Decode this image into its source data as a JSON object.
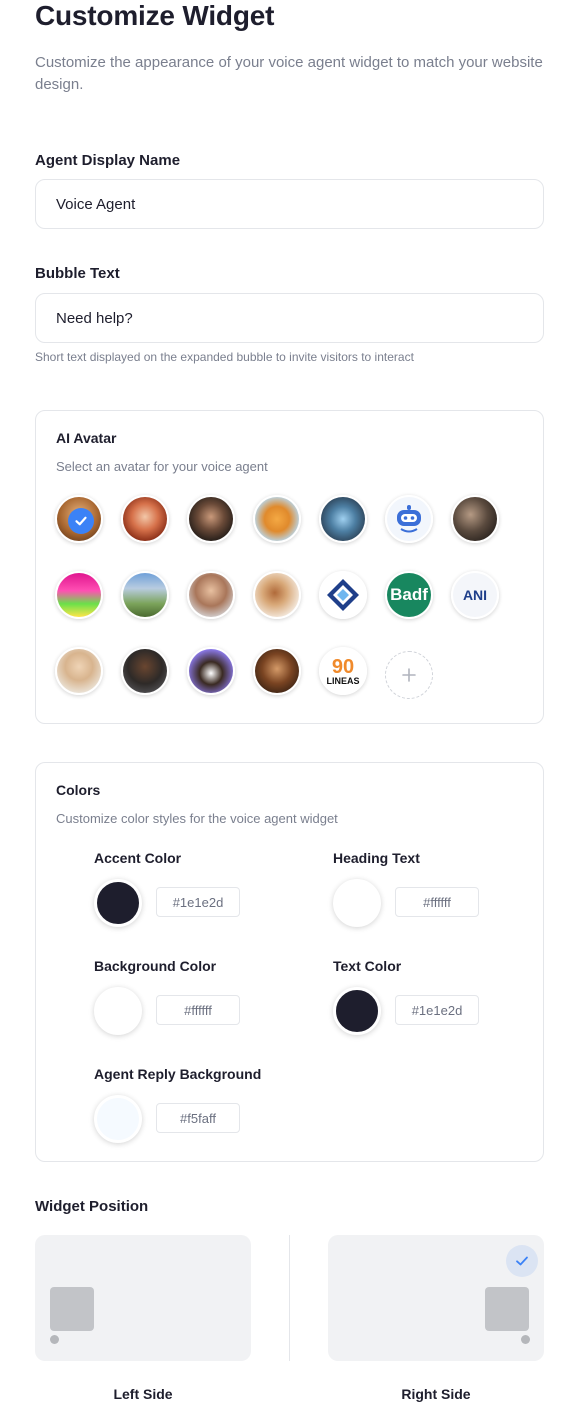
{
  "header": {
    "title": "Customize Widget",
    "subtitle": "Customize the appearance of your voice agent widget to match your website design."
  },
  "agent_name": {
    "label": "Agent Display Name",
    "value": "Voice Agent"
  },
  "bubble": {
    "label": "Bubble Text",
    "value": "Need help?",
    "hint": "Short text displayed on the expanded bubble to invite visitors to interact"
  },
  "avatars": {
    "title": "AI Avatar",
    "subtitle": "Select an avatar for your voice agent",
    "selected_index": 0,
    "items": [
      {
        "name": "avatar-1",
        "color": "#c58a52"
      },
      {
        "name": "avatar-2",
        "color": "#b4532e"
      },
      {
        "name": "avatar-3",
        "color": "#3a2e28"
      },
      {
        "name": "avatar-4",
        "color": "#e69a3c"
      },
      {
        "name": "avatar-5",
        "color": "#4a6d8c"
      },
      {
        "name": "avatar-6",
        "color": "#eef3fb"
      },
      {
        "name": "avatar-7",
        "color": "#4b4038"
      },
      {
        "name": "avatar-8",
        "color": "#d93b9b"
      },
      {
        "name": "avatar-9",
        "color": "#8aa36b"
      },
      {
        "name": "avatar-10",
        "color": "#c9a48a"
      },
      {
        "name": "avatar-11",
        "color": "#d7b287"
      },
      {
        "name": "avatar-12",
        "color": "#2a4a9a"
      },
      {
        "name": "avatar-13",
        "color": "#1a8a63"
      },
      {
        "name": "avatar-14",
        "color": "#f1f3f8"
      },
      {
        "name": "avatar-15",
        "color": "#dcc6a8"
      },
      {
        "name": "avatar-16",
        "color": "#3a3a3e"
      },
      {
        "name": "avatar-17",
        "color": "#8f7df2"
      },
      {
        "name": "avatar-18",
        "color": "#6b3f22"
      },
      {
        "name": "avatar-19",
        "color": "#f08a2b"
      }
    ],
    "logo_texts": {
      "badf": "Badf",
      "ani": "ANI",
      "ninety": "90",
      "lineas": "LINEAS"
    }
  },
  "colors": {
    "title": "Colors",
    "subtitle": "Customize color styles for the voice agent widget",
    "items": [
      {
        "label": "Accent Color",
        "hex": "#1e1e2d",
        "swatch": "#1e1e2d"
      },
      {
        "label": "Heading Text",
        "hex": "#ffffff",
        "swatch": "#ffffff"
      },
      {
        "label": "Background Color",
        "hex": "#ffffff",
        "swatch": "#ffffff"
      },
      {
        "label": "Text Color",
        "hex": "#1e1e2d",
        "swatch": "#1e1e2d"
      },
      {
        "label": "Agent Reply Background",
        "hex": "#f5faff",
        "swatch": "#f5faff"
      }
    ]
  },
  "position": {
    "label": "Widget Position",
    "selected": "right",
    "left_label": "Left Side",
    "right_label": "Right Side"
  }
}
